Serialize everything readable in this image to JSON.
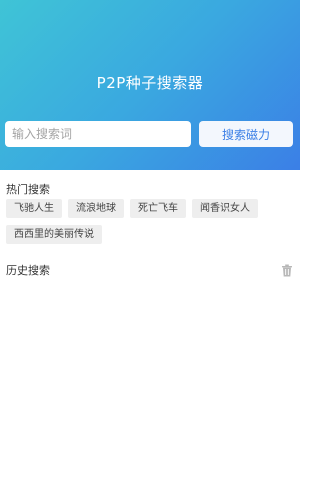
{
  "app": {
    "title": "P2P种子搜索器"
  },
  "search": {
    "placeholder": "输入搜索词",
    "value": "",
    "button_label": "搜索磁力"
  },
  "hot": {
    "title": "热门搜索",
    "tags": [
      "飞驰人生",
      "流浪地球",
      "死亡飞车",
      "闻香识女人",
      "西西里的美丽传说"
    ]
  },
  "history": {
    "title": "历史搜索",
    "items": []
  },
  "icons": {
    "clear_history": "trash-icon"
  },
  "colors": {
    "header_start": "#3fc4d6",
    "header_end": "#3b7fe6",
    "accent": "#3b7fe6"
  }
}
